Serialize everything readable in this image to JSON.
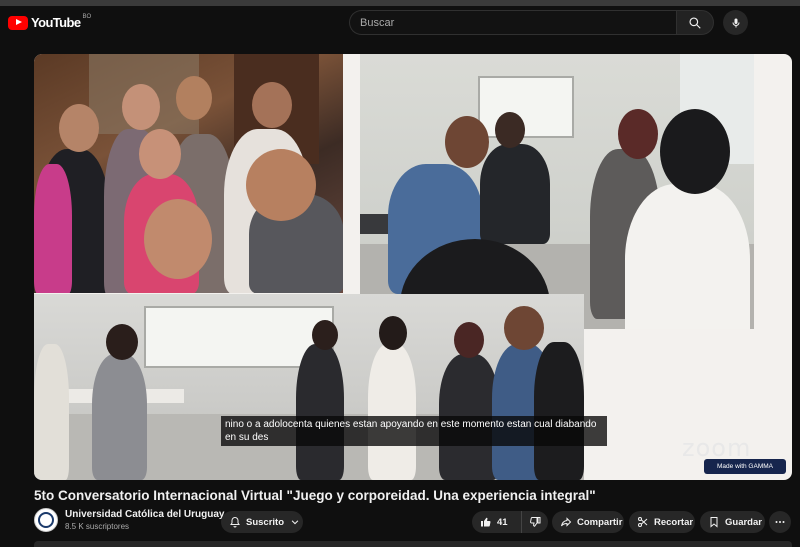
{
  "header": {
    "logo_text": "YouTube",
    "logo_country": "BO",
    "search_placeholder": "Buscar"
  },
  "video": {
    "subtitle_line1": "nino o a adolocenta quienes estan apoyando en este momento estan cual diabando",
    "subtitle_line2": "en su des",
    "watermark": "zoom",
    "badge": "Made with GAMMA"
  },
  "meta": {
    "title": "5to Conversatorio Internacional Virtual \"Juego y corporeidad. Una experiencia integral\"",
    "channel_name": "Universidad Católica del Uruguay",
    "subscribers": "8.5 K suscriptores"
  },
  "actions": {
    "subscribed": "Suscrito",
    "likes": "41",
    "share": "Compartir",
    "clip": "Recortar",
    "save": "Guardar"
  },
  "colors": {
    "brand": "#ff0000",
    "background": "#0f0f0f",
    "pill": "#272727"
  },
  "icons": [
    "youtube-logo-icon",
    "search-icon",
    "mic-icon",
    "bell-icon",
    "chevron-down-icon",
    "thumbs-up-icon",
    "thumbs-down-icon",
    "share-icon",
    "scissors-icon",
    "bookmark-icon",
    "more-icon"
  ]
}
